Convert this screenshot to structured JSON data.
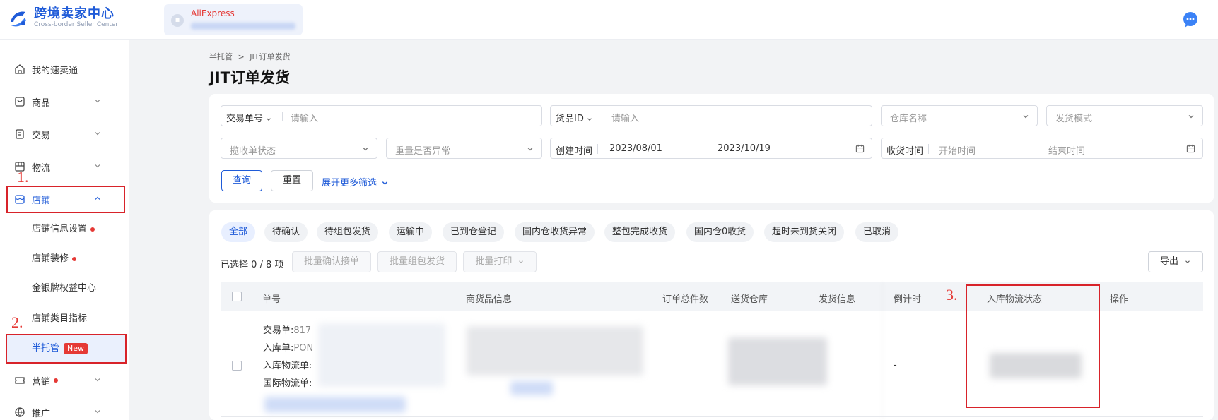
{
  "header": {
    "logo_title": "跨境卖家中心",
    "logo_subtitle": "Cross-border Seller Center",
    "store_brand": "AliExpress"
  },
  "sidebar": {
    "items": [
      {
        "label": "我的速卖通"
      },
      {
        "label": "商品"
      },
      {
        "label": "交易"
      },
      {
        "label": "物流"
      },
      {
        "label": "店铺"
      },
      {
        "label": "营销"
      },
      {
        "label": "推广"
      }
    ],
    "shop_sub": [
      {
        "label": "店铺信息设置"
      },
      {
        "label": "店铺装修"
      },
      {
        "label": "金银牌权益中心"
      },
      {
        "label": "店铺类目指标"
      },
      {
        "label": "半托管",
        "badge": "New"
      }
    ]
  },
  "annotations": {
    "a1": "1.",
    "a2": "2.",
    "a3": "3."
  },
  "breadcrumb": {
    "parent": "半托管",
    "separator": ">",
    "current": "JIT订单发货"
  },
  "page_title": "JIT订单发货",
  "filters": {
    "trade_no_label": "交易单号",
    "trade_no_placeholder": "请输入",
    "goods_id_label": "货品ID",
    "goods_id_placeholder": "请输入",
    "warehouse_placeholder": "仓库名称",
    "ship_mode_placeholder": "发货模式",
    "pickup_status_placeholder": "揽收单状态",
    "weight_abnormal_placeholder": "重量是否异常",
    "created_label": "创建时间",
    "created_start": "2023/08/01",
    "created_end": "2023/10/19",
    "received_label": "收货时间",
    "received_start_placeholder": "开始时间",
    "received_end_placeholder": "结束时间",
    "query_button": "查询",
    "reset_button": "重置",
    "more_filters": "展开更多筛选"
  },
  "tabs": [
    "全部",
    "待确认",
    "待组包发货",
    "运输中",
    "已到仓登记",
    "国内仓收货异常",
    "整包完成收货",
    "国内仓0收货",
    "超时未到货关闭",
    "已取消"
  ],
  "selection": {
    "text": "已选择 0 / 8 项"
  },
  "batch": {
    "confirm": "批量确认接单",
    "pack": "批量组包发货",
    "print": "批量打印",
    "export": "导出"
  },
  "table": {
    "headers": {
      "order_no": "单号",
      "goods_info": "商货品信息",
      "total_qty": "订单总件数",
      "warehouse": "送货仓库",
      "ship_info": "发货信息",
      "countdown": "倒计时",
      "inbound_status": "入库物流状态",
      "action": "操作"
    },
    "row": {
      "trade_label": "交易单:",
      "trade_value": "817",
      "inbound_label": "入库单:",
      "inbound_value": "PON",
      "inbound_logistics_label": "入库物流单:",
      "intl_logistics_label": "国际物流单:",
      "countdown": "-"
    }
  },
  "colors": {
    "brand": "#1f5bd8",
    "annotation": "#d8232a"
  }
}
